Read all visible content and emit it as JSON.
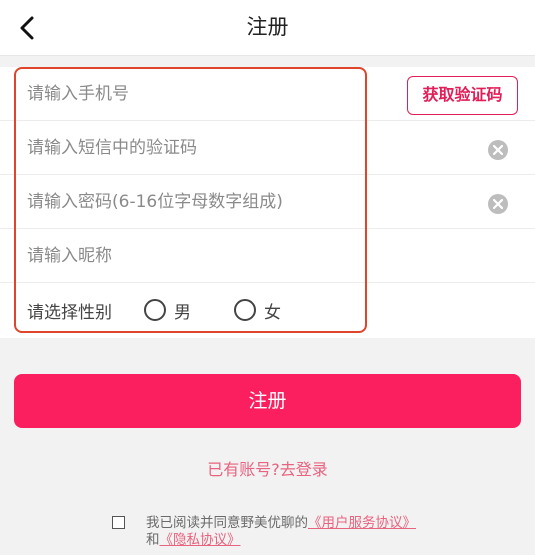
{
  "header": {
    "title": "注册"
  },
  "form": {
    "phone_placeholder": "请输入手机号",
    "get_code_label": "获取验证码",
    "sms_code_placeholder": "请输入短信中的验证码",
    "password_placeholder": "请输入密码(6-16位字母数字组成)",
    "nickname_placeholder": "请输入昵称",
    "gender_label": "请选择性别",
    "gender_options": [
      "男",
      "女"
    ]
  },
  "actions": {
    "register_label": "注册",
    "login_link": "已有账号?去登录"
  },
  "agreement": {
    "prefix": "我已阅读并同意野美优聊的",
    "user_agreement": "《用户服务协议》",
    "connector": "和",
    "privacy_agreement": "《隐私协议》"
  },
  "colors": {
    "accent": "#fc1f5f",
    "link": "#e8637f",
    "highlight_border": "#e0452c"
  },
  "icons": {
    "back": "chevron-left-icon",
    "clear": "clear-circle-icon"
  }
}
